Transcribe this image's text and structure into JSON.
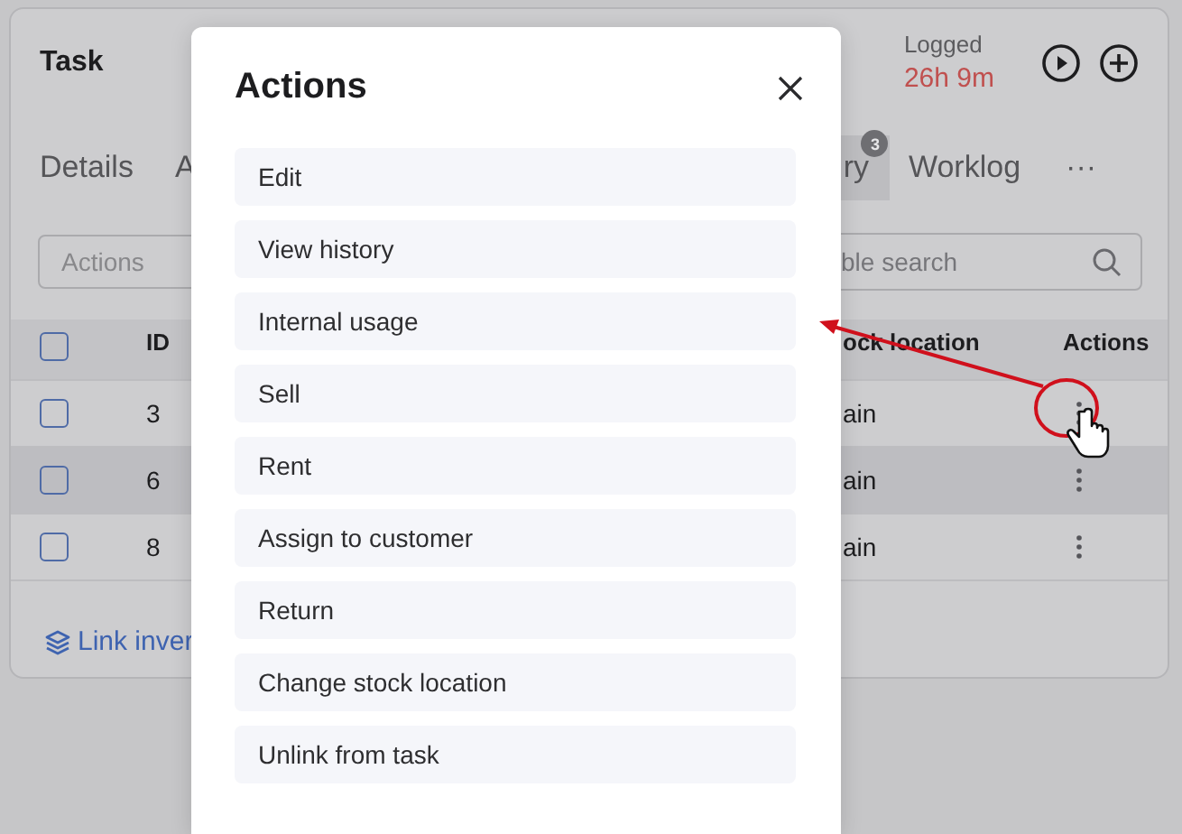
{
  "task": {
    "title": "Task",
    "logged_label": "Logged",
    "logged_value": "26h 9m"
  },
  "tabs": [
    {
      "label": "Details",
      "selected": false
    },
    {
      "label": "A",
      "selected": false
    },
    {
      "label": "ry",
      "selected": true,
      "badge": "3"
    },
    {
      "label": "Worklog",
      "selected": false
    },
    {
      "label": "···",
      "selected": false
    }
  ],
  "toolbar": {
    "dropdown": "Actions",
    "search_placeholder": "ble search"
  },
  "table": {
    "header_checked": false,
    "columns": [
      {
        "label": "ID"
      },
      {
        "label": "ock location"
      },
      {
        "label": "Actions"
      }
    ],
    "rows": [
      {
        "id": "3",
        "location": "ain",
        "checked": false,
        "selected": false
      },
      {
        "id": "6",
        "location": "ain",
        "checked": false,
        "selected": true
      },
      {
        "id": "8",
        "location": "ain",
        "checked": false,
        "selected": false
      }
    ]
  },
  "link": "Link inver",
  "modal": {
    "title": "Actions",
    "items": [
      "Edit",
      "View history",
      "Internal usage",
      "Sell",
      "Rent",
      "Assign to customer",
      "Return",
      "Change stock location",
      "Unlink from task"
    ]
  }
}
